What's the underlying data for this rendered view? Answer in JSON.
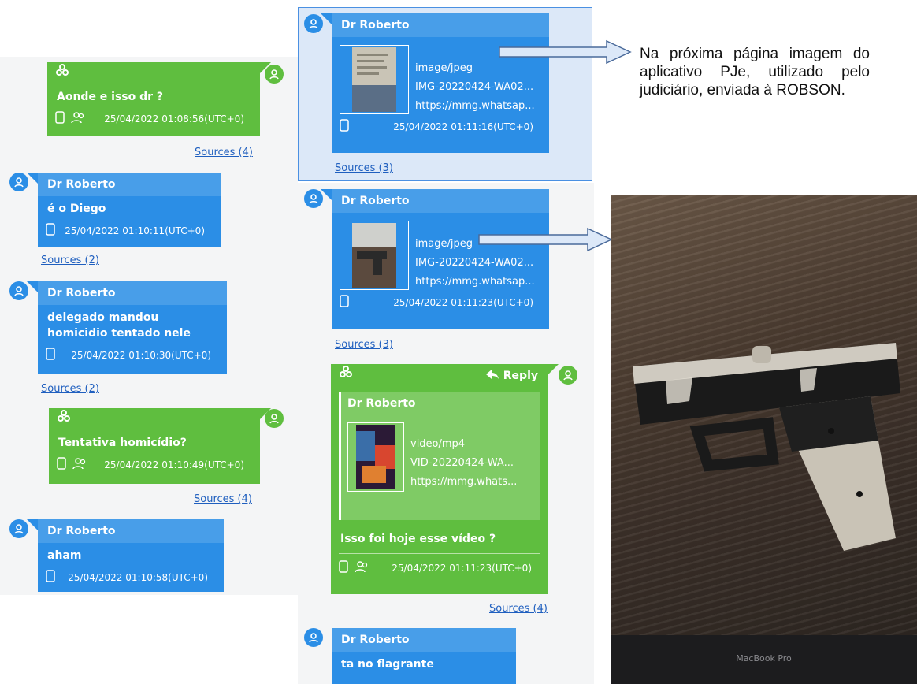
{
  "colors": {
    "blue_bubble": "#2b8ee6",
    "green_bubble": "#5fbe3f",
    "link": "#1f5fbf"
  },
  "left": {
    "m1": {
      "text": "Aonde e isso dr ?",
      "timestamp": "25/04/2022 01:08:56(UTC+0)",
      "sources": "Sources (4)"
    },
    "m2": {
      "sender": "Dr Roberto",
      "text": "é o Diego",
      "timestamp": "25/04/2022 01:10:11(UTC+0)",
      "sources": "Sources (2)"
    },
    "m3": {
      "sender": "Dr Roberto",
      "text": "delegado mandou homicidio tentado nele",
      "timestamp": "25/04/2022 01:10:30(UTC+0)",
      "sources": "Sources (2)"
    },
    "m4": {
      "text": "Tentativa homicídio?",
      "timestamp": "25/04/2022 01:10:49(UTC+0)",
      "sources": "Sources (4)"
    },
    "m5": {
      "sender": "Dr Roberto",
      "text": "aham",
      "timestamp": "25/04/2022 01:10:58(UTC+0)"
    }
  },
  "mid": {
    "m1": {
      "sender": "Dr Roberto",
      "mime": "image/jpeg",
      "filename": "IMG-20220424-WA02...",
      "url": "https://mmg.whatsap...",
      "timestamp": "25/04/2022 01:11:16(UTC+0)",
      "sources": "Sources (3)"
    },
    "m2": {
      "sender": "Dr Roberto",
      "mime": "image/jpeg",
      "filename": "IMG-20220424-WA02...",
      "url": "https://mmg.whatsap...",
      "timestamp": "25/04/2022 01:11:23(UTC+0)",
      "sources": "Sources (3)"
    },
    "m3": {
      "reply_label": "Reply",
      "quoted_sender": "Dr Roberto",
      "mime": "video/mp4",
      "filename": "VID-20220424-WA...",
      "url": "https://mmg.whats...",
      "text": "Isso foi hoje esse vídeo ?",
      "timestamp": "25/04/2022 01:11:23(UTC+0)",
      "sources": "Sources (4)"
    },
    "m4": {
      "sender": "Dr Roberto",
      "text": "ta no flagrante"
    }
  },
  "annotation": {
    "text": "Na próxima página imagem do aplicativo PJe, utilizado pelo judiciário, enviada à ROBSON."
  },
  "photo": {
    "laptop_label": "MacBook Pro"
  }
}
